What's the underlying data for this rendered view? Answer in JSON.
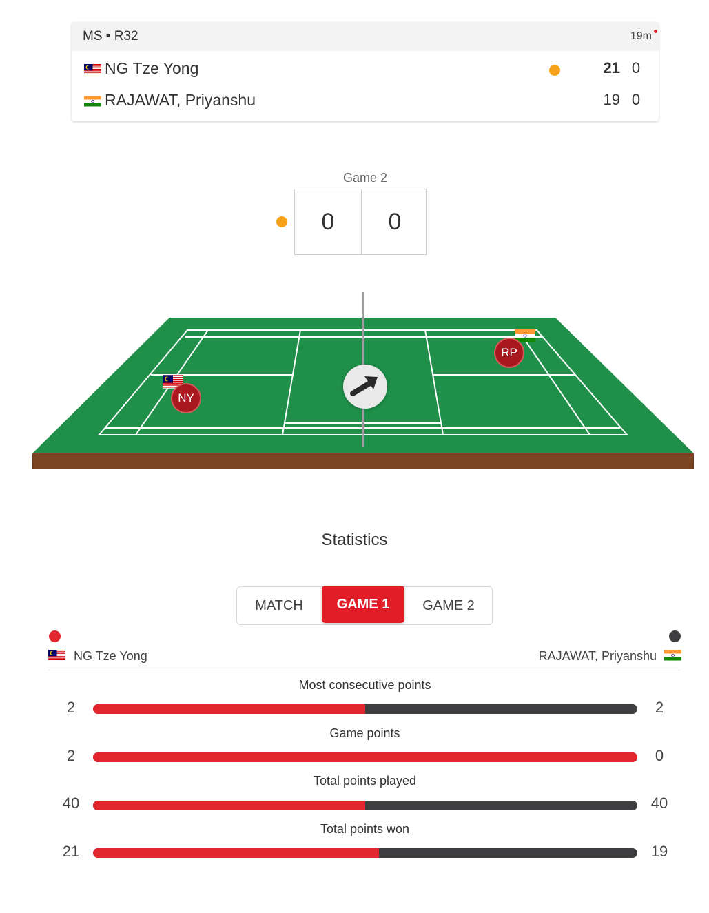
{
  "match": {
    "round": "MS • R32",
    "elapsed": "19m",
    "players": [
      {
        "name": "NG Tze Yong",
        "initials": "NY",
        "flag": "malaysia-flag-icon",
        "game1": "21",
        "game2": "0",
        "serving": true
      },
      {
        "name": "RAJAWAT, Priyanshu",
        "initials": "RP",
        "flag": "india-flag-icon",
        "game1": "19",
        "game2": "0",
        "serving": false
      }
    ]
  },
  "current_game": {
    "label": "Game 2",
    "score_left": "0",
    "score_right": "0"
  },
  "court": {
    "switch_icon": "arrow-up-right-icon"
  },
  "statistics": {
    "title": "Statistics",
    "tabs": [
      "MATCH",
      "GAME 1",
      "GAME 2"
    ],
    "active_tab": "GAME 1",
    "left_player": "NG Tze Yong",
    "right_player": "RAJAWAT, Priyanshu",
    "colors": {
      "left": "#e1262e",
      "right": "#3f3f42",
      "serve": "#f7a21b"
    },
    "rows": [
      {
        "title": "Most consecutive points",
        "left": "2",
        "right": "2",
        "left_share": 0.5
      },
      {
        "title": "Game points",
        "left": "2",
        "right": "0",
        "left_share": 1.0
      },
      {
        "title": "Total points played",
        "left": "40",
        "right": "40",
        "left_share": 0.5
      },
      {
        "title": "Total points won",
        "left": "21",
        "right": "19",
        "left_share": 0.525
      }
    ]
  }
}
